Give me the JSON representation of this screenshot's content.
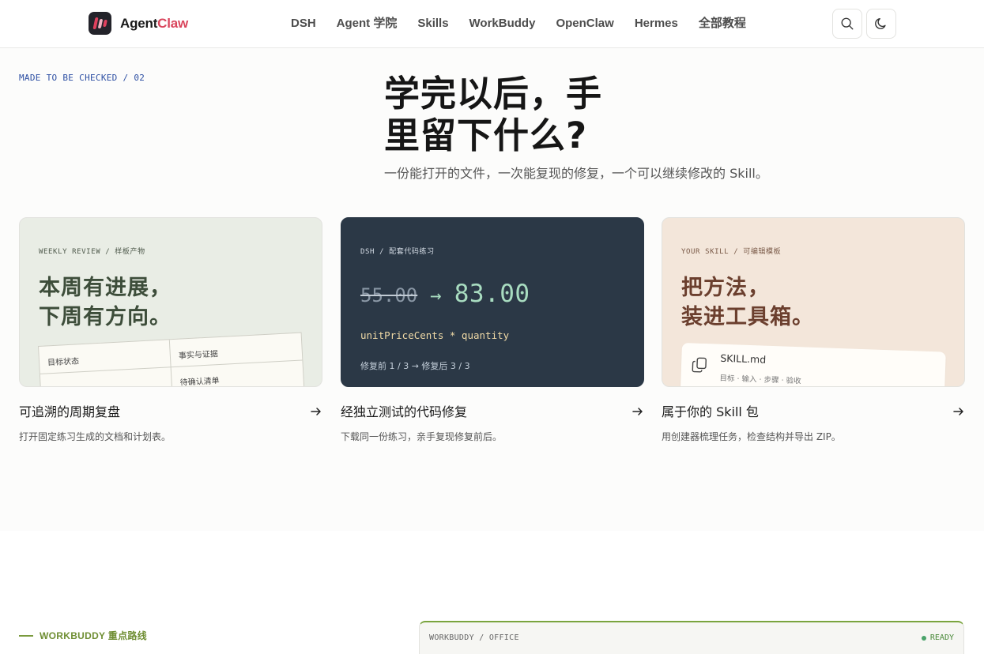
{
  "nav": {
    "brand_a": "Agent",
    "brand_b": "Claw",
    "links": [
      "DSH",
      "Agent 学院",
      "Skills",
      "WorkBuddy",
      "OpenClaw",
      "Hermes",
      "全部教程"
    ],
    "search_icon": "search-icon",
    "theme_icon": "moon-icon"
  },
  "hero": {
    "eyebrow": "MADE TO BE CHECKED / 02",
    "title_line1": "学完以后，手",
    "title_line2": "里留下什么?",
    "subtitle": "一份能打开的文件，一次能复现的修复，一个可以继续修改的 Skill。"
  },
  "cards": [
    {
      "kicker": "WEEKLY REVIEW / 样板产物",
      "big_line1": "本周有进展，",
      "big_line2": "下周有方向。",
      "table": {
        "c1": "目标状态",
        "c2": "事实与证据",
        "c3": "待确认清单"
      },
      "title": "可追溯的周期复盘",
      "desc": "打开固定练习生成的文档和计划表。"
    },
    {
      "kicker": "DSH / 配套代码练习",
      "price_old": "55.00",
      "price_arrow": "→",
      "price_new": "83.00",
      "code": "unitPriceCents * quantity",
      "meta": "修复前 1 / 3 → 修复后 3 / 3",
      "title": "经独立测试的代码修复",
      "desc": "下载同一份练习，亲手复现修复前后。"
    },
    {
      "kicker": "YOUR SKILL / 可编辑模板",
      "big_line1": "把方法，",
      "big_line2": "装进工具箱。",
      "file_name": "SKILL.md",
      "file_tags": "目标 · 输入 · 步骤 · 验收",
      "title": "属于你的 Skill 包",
      "desc": "用创建器梳理任务，检查结构并导出 ZIP。"
    }
  ],
  "bottom": {
    "route_label": "WORKBUDDY 重点路线",
    "panel_label": "WORKBUDDY / OFFICE",
    "panel_status": "READY"
  },
  "colors": {
    "brand_red": "#d9455c",
    "eyebrow_blue": "#2d4fa3",
    "card_sage": "#e9ede5",
    "card_navy": "#2b3846",
    "card_sand": "#f3e6da",
    "accent_green": "#7aa43e"
  }
}
